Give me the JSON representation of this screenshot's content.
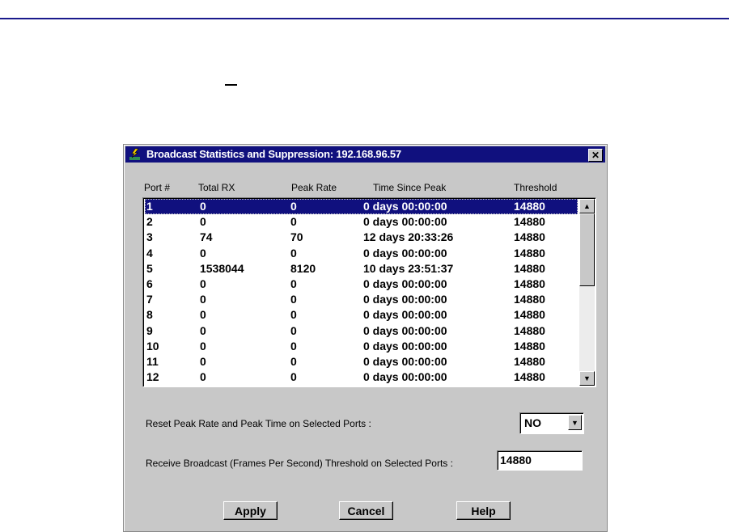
{
  "dialog": {
    "title": "Broadcast Statistics and Suppression: 192.168.96.57",
    "close_label": "✕"
  },
  "table": {
    "headers": [
      "Port #",
      "Total RX",
      "Peak Rate",
      "Time Since Peak",
      "Threshold"
    ],
    "rows": [
      [
        "1",
        "0",
        "0",
        "0 days 00:00:00",
        "14880"
      ],
      [
        "2",
        "0",
        "0",
        "0 days 00:00:00",
        "14880"
      ],
      [
        "3",
        "74",
        "70",
        "12 days 20:33:26",
        "14880"
      ],
      [
        "4",
        "0",
        "0",
        "0 days 00:00:00",
        "14880"
      ],
      [
        "5",
        "1538044",
        "8120",
        "10 days 23:51:37",
        "14880"
      ],
      [
        "6",
        "0",
        "0",
        "0 days 00:00:00",
        "14880"
      ],
      [
        "7",
        "0",
        "0",
        "0 days 00:00:00",
        "14880"
      ],
      [
        "8",
        "0",
        "0",
        "0 days 00:00:00",
        "14880"
      ],
      [
        "9",
        "0",
        "0",
        "0 days 00:00:00",
        "14880"
      ],
      [
        "10",
        "0",
        "0",
        "0 days 00:00:00",
        "14880"
      ],
      [
        "11",
        "0",
        "0",
        "0 days 00:00:00",
        "14880"
      ],
      [
        "12",
        "0",
        "0",
        "0 days 00:00:00",
        "14880"
      ]
    ],
    "selected_index": 0
  },
  "reset": {
    "label": "Reset Peak Rate and Peak Time on Selected Ports :",
    "value": "NO"
  },
  "threshold": {
    "label": "Receive Broadcast (Frames Per Second) Threshold on Selected Ports :",
    "value": "14880"
  },
  "buttons": {
    "apply": "Apply",
    "cancel": "Cancel",
    "help": "Help"
  },
  "colors": {
    "titlebar": "#10107e",
    "dialog": "#c8c8c8"
  }
}
